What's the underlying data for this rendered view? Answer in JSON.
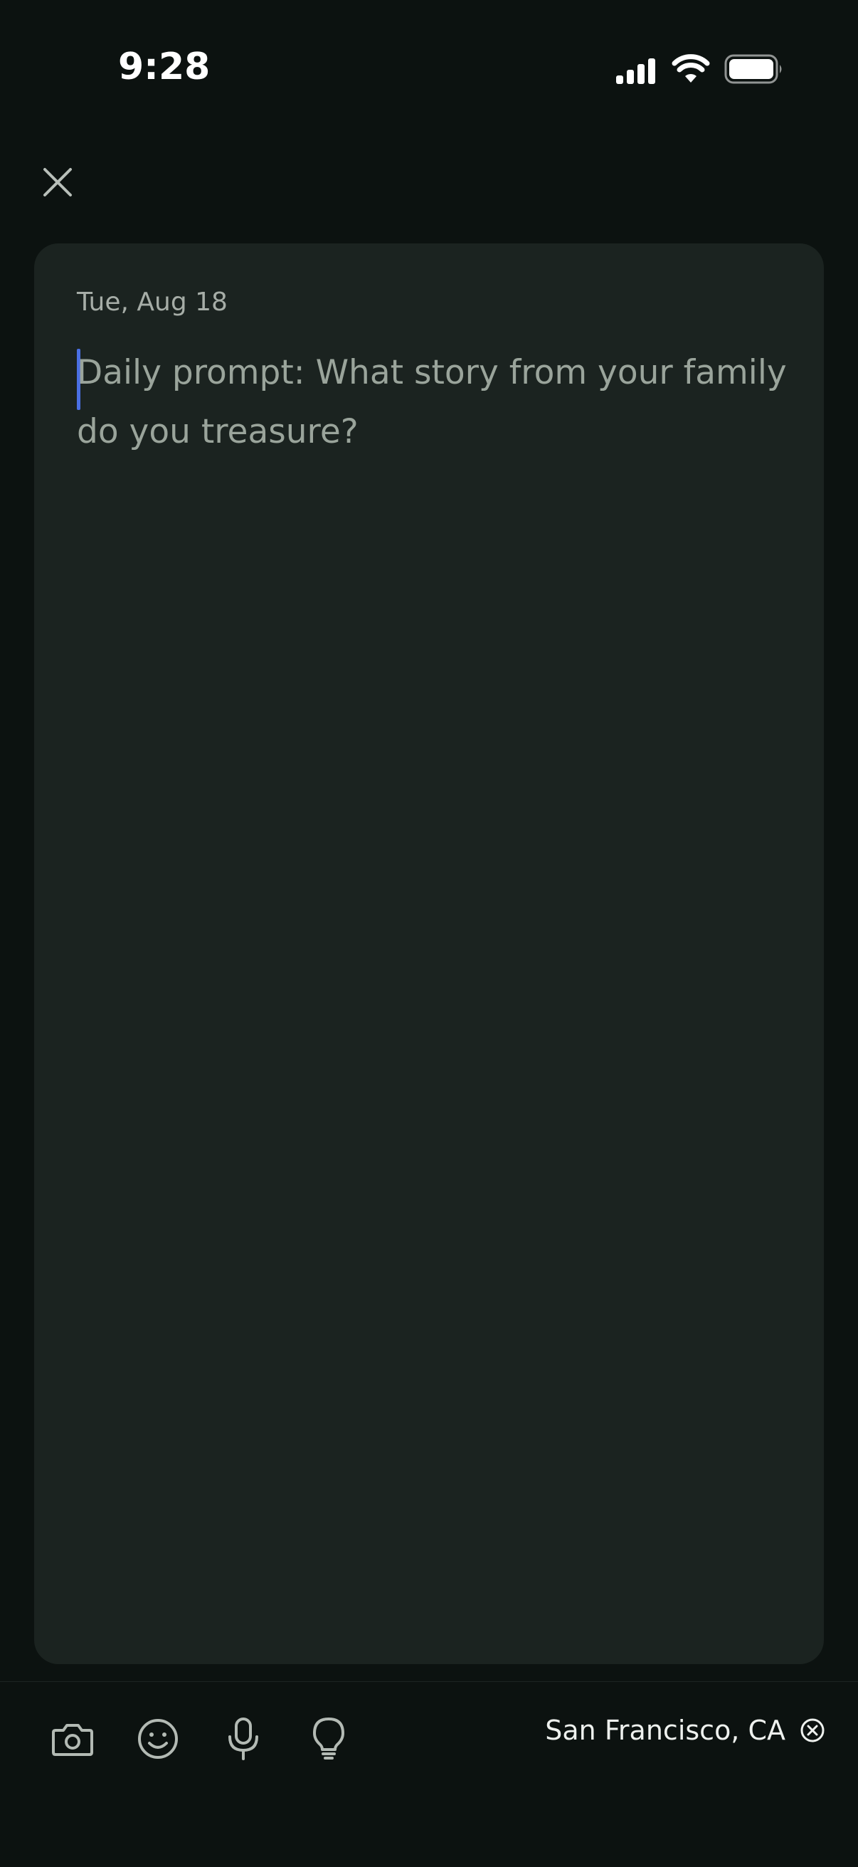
{
  "status_bar": {
    "time": "9:28",
    "icons": [
      "cellular-signal-icon",
      "wifi-icon",
      "battery-icon"
    ]
  },
  "header": {
    "close_icon": "close-icon"
  },
  "entry": {
    "date": "Tue, Aug 18",
    "prompt": "Daily prompt: What story from your family do you treasure?"
  },
  "toolbar": {
    "tools": [
      "camera-icon",
      "emoji-icon",
      "microphone-icon",
      "lightbulb-icon"
    ],
    "location": "San Francisco, CA",
    "location_clear_icon": "clear-location-icon"
  },
  "colors": {
    "background": "#0c1210",
    "card": "#1b2320",
    "caret": "#4a6fe3",
    "prompt_text": "#9aa49b"
  }
}
